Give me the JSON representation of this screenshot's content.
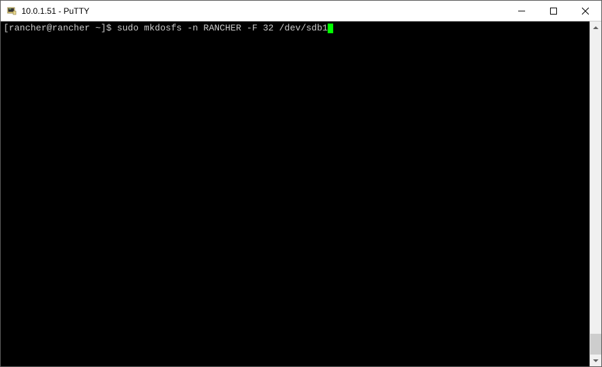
{
  "window": {
    "title": "10.0.1.51 - PuTTY"
  },
  "terminal": {
    "prompt": "[rancher@rancher ~]$ ",
    "command": "sudo mkdosfs -n RANCHER -F 32 /dev/sdb1"
  }
}
